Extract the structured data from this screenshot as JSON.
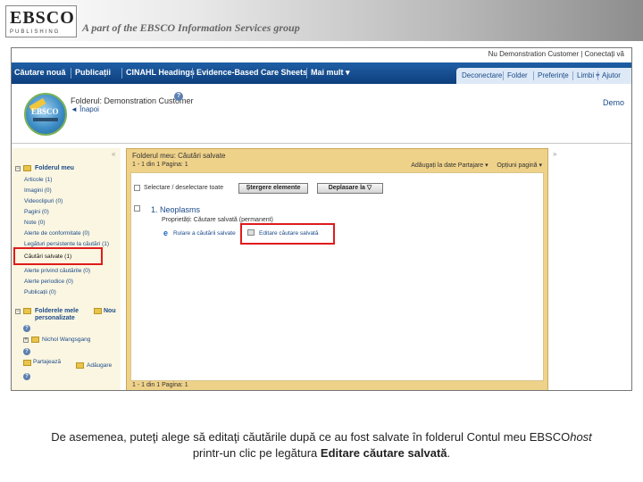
{
  "banner": {
    "logo_word": "EBSCO",
    "logo_sub": "PUBLISHING",
    "tagline": "A part of the EBSCO Information Services group"
  },
  "topbar": {
    "user_info": "Nu Demonstration Customer | Conectați vă"
  },
  "nav": {
    "items": [
      "Căutare nouă",
      "Publicații",
      "CINAHL Headings",
      "Evidence-Based Care Sheets",
      "Mai mult ▾"
    ],
    "right_items": [
      "Deconectare",
      "Folder",
      "Preferințe",
      "Limbi ▾",
      "Ajutor"
    ]
  },
  "header": {
    "folder_title": "Folderul: Demonstration Customer",
    "back": "◄ Înapoi",
    "demo": "Demo"
  },
  "sidebar": {
    "my_folder": "Folderul meu",
    "items": [
      "Articole (1)",
      "Imagini (0)",
      "Videoclipuri (0)",
      "Pagini (0)",
      "Note (0)",
      "Alerte de conformitate (0)",
      "Legături persistente la căutări (1)",
      "Căutări salvate (1)",
      "Alerte privind căutările (0)",
      "Alerte periodice (0)",
      "Publicații (0)"
    ],
    "my_custom": "Folderele mele personalizate",
    "new_label": "Nou",
    "nw_folder": "Nichol Wangsgang",
    "parts_label": "Partajează",
    "add_label": "Adăugare"
  },
  "main": {
    "title": "Folderul meu: Căutări salvate",
    "pager_top": "1 - 1 din 1   Pagina: 1",
    "pager_bottom": "1 - 1 din 1   Pagina: 1",
    "add_to_share": "Adăugați la date Partajare ▾",
    "page_options": "Opțiuni pagină ▾",
    "select_label": "Selectare / deselectare toate",
    "delete_button": "Ștergere elemente",
    "move_button": "Deplasare la",
    "result": {
      "title": "1. Neoplasms",
      "meta": "Proprietăți: Căutare salvată (permanent)",
      "link_run": "Rulare a căutării salvate",
      "link_edit": "Editare căutare salvată"
    }
  },
  "caption": {
    "part1": "De asemenea, puteţi alege să editaţi căutările după ce au fost salvate în folderul Contul meu EBSCO",
    "italic": "host",
    "part2": "printr-un clic pe legătura ",
    "bold": "Editare căutare salvată",
    "end": "."
  }
}
